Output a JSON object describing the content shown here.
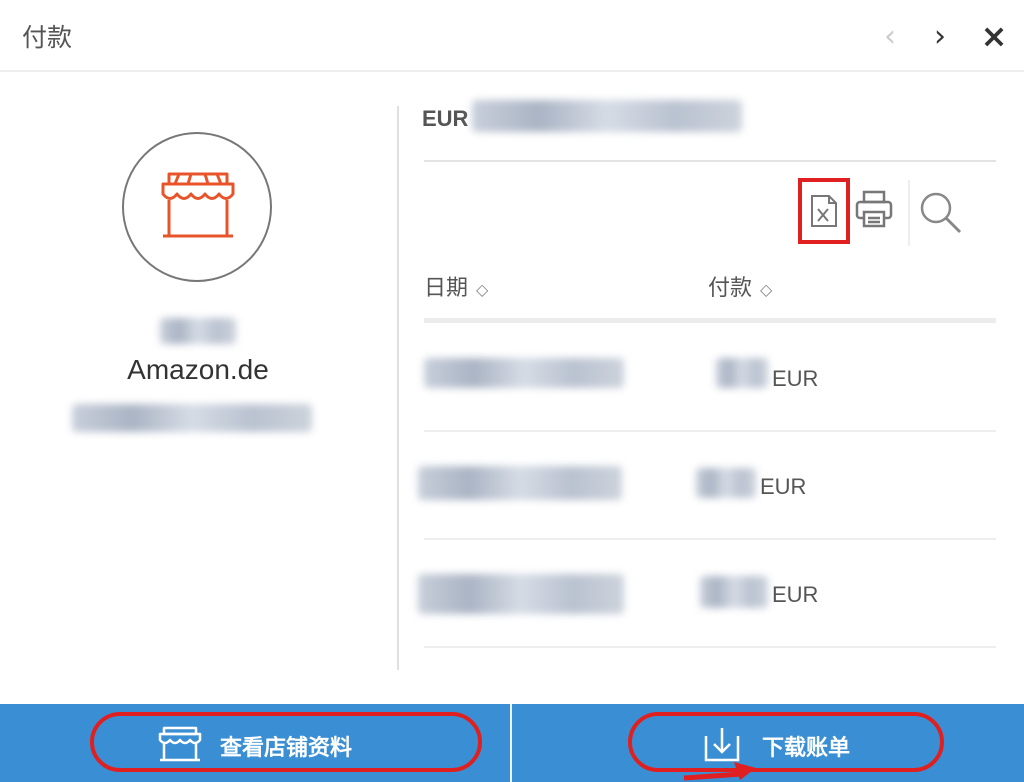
{
  "header": {
    "title": "付款",
    "prev_icon": "‹",
    "next_icon": "›",
    "close_icon": "×"
  },
  "store": {
    "icon": "storefront-icon",
    "name": "Amazon.de"
  },
  "balance": {
    "currency": "EUR"
  },
  "toolbar": {
    "excel_icon": "excel-export-icon",
    "print_icon": "printer-icon",
    "search_icon": "search-icon"
  },
  "table": {
    "columns": [
      {
        "label": "日期",
        "sort": "◇"
      },
      {
        "label": "付款",
        "sort": "◇"
      }
    ],
    "rows": [
      {
        "currency": "EUR"
      },
      {
        "currency": "EUR"
      },
      {
        "currency": "EUR"
      }
    ]
  },
  "footer": {
    "view_store_label": "查看店铺资料",
    "download_label": "下载账单"
  },
  "colors": {
    "accent_blue": "#3a8fd4",
    "store_orange": "#e8542a",
    "highlight_red": "#e02020"
  }
}
